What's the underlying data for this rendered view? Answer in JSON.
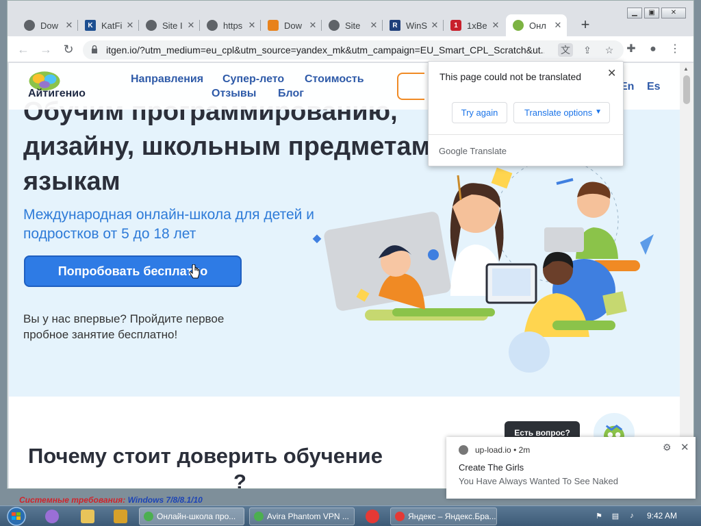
{
  "browser": {
    "tabs": [
      {
        "title": "Dow",
        "favicon_color": "#5f6368",
        "favicon_glyph": ""
      },
      {
        "title": "KatFi",
        "favicon_color": "#1d4f91",
        "favicon_glyph": "K"
      },
      {
        "title": "Site I",
        "favicon_color": "#5f6368",
        "favicon_glyph": ""
      },
      {
        "title": "https",
        "favicon_color": "#5f6368",
        "favicon_glyph": ""
      },
      {
        "title": "Dow",
        "favicon_color": "#e8821c",
        "favicon_glyph": ""
      },
      {
        "title": "Site",
        "favicon_color": "#5f6368",
        "favicon_glyph": ""
      },
      {
        "title": "WinS",
        "favicon_color": "#1f3f7a",
        "favicon_glyph": "R"
      },
      {
        "title": "1xBe",
        "favicon_color": "#c8202c",
        "favicon_glyph": "1"
      },
      {
        "title": "Онл",
        "favicon_color": "#7cb342",
        "favicon_glyph": ""
      }
    ],
    "new_tab_label": "+",
    "url": "itgen.io/?utm_medium=eu_cpl&utm_source=yandex_mk&utm_campaign=EU_Smart_CPL_Scratch&ut..."
  },
  "site": {
    "logo_text": "Айтигенио",
    "nav": [
      "Направления",
      "Супер-лето",
      "Стоимость",
      "Отзывы",
      "Блог"
    ],
    "langs": [
      "En",
      "Es"
    ],
    "headline": "Обучим программированию, дизайну, школьным предметам и языкам",
    "subtitle": "Международная онлайн-школа для детей и подростков от 5 до 18 лет",
    "cta": "Попробовать бесплатно",
    "first_time": "Вы у нас впервые? Пройдите первое пробное занятие бесплатно!",
    "why_title": "Почему стоит доверить обучение",
    "why_title_cut": "?",
    "ask_question": "Есть вопрос?"
  },
  "translate_popup": {
    "message": "This page could not be translated",
    "try_again": "Try again",
    "options": "Translate options",
    "brand_google": "Google",
    "brand_translate": "Translate"
  },
  "notification": {
    "source": "up-load.io",
    "time": "• 2m",
    "title": "Create The Girls",
    "body": "You Have Always Wanted To See Naked"
  },
  "sysreq": {
    "label": "Системные требования:",
    "value": "Windows 7/8/8.1/10"
  },
  "taskbar": {
    "tasks": [
      {
        "title": "Онлайн-школа про...",
        "color": "#4caf50"
      },
      {
        "title": "Avira Phantom VPN ...",
        "color": "#4caf50"
      },
      {
        "title": "Яндекс – Яндекс.Бра...",
        "color": "#e53935"
      }
    ],
    "clock": "9:42 AM"
  },
  "colors": {
    "accent_blue": "#2e7be5",
    "nav_blue": "#2e5aa8",
    "hero_bg": "#e5f3fc"
  }
}
